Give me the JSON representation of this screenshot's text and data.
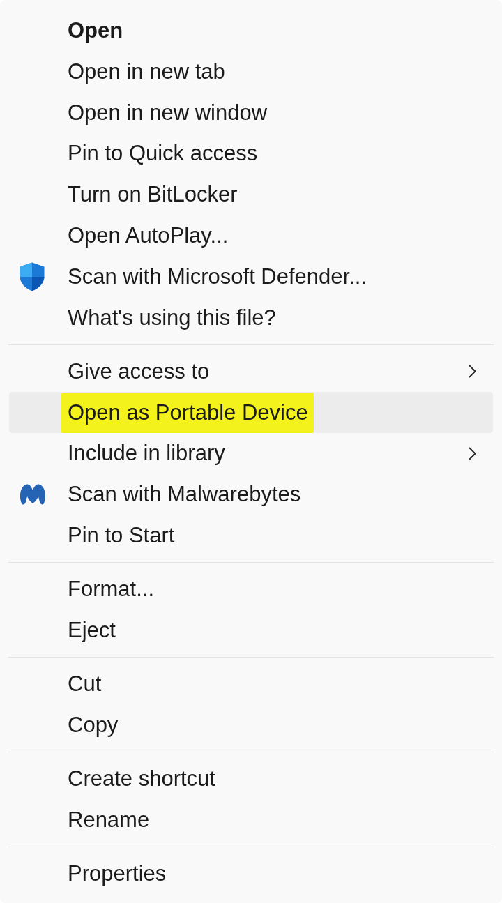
{
  "menu": {
    "groups": [
      {
        "items": [
          {
            "label": "Open",
            "kind": "plain",
            "default": true,
            "submenu": false,
            "selected": false,
            "highlighted": false
          },
          {
            "label": "Open in new tab",
            "kind": "plain",
            "default": false,
            "submenu": false,
            "selected": false,
            "highlighted": false
          },
          {
            "label": "Open in new window",
            "kind": "plain",
            "default": false,
            "submenu": false,
            "selected": false,
            "highlighted": false
          },
          {
            "label": "Pin to Quick access",
            "kind": "plain",
            "default": false,
            "submenu": false,
            "selected": false,
            "highlighted": false
          },
          {
            "label": "Turn on BitLocker",
            "kind": "plain",
            "default": false,
            "submenu": false,
            "selected": false,
            "highlighted": false
          },
          {
            "label": "Open AutoPlay...",
            "kind": "plain",
            "default": false,
            "submenu": false,
            "selected": false,
            "highlighted": false
          },
          {
            "label": "Scan with Microsoft Defender...",
            "kind": "shield",
            "default": false,
            "submenu": false,
            "selected": false,
            "highlighted": false
          },
          {
            "label": "What's using this file?",
            "kind": "plain",
            "default": false,
            "submenu": false,
            "selected": false,
            "highlighted": false
          }
        ]
      },
      {
        "items": [
          {
            "label": "Give access to",
            "kind": "plain",
            "default": false,
            "submenu": true,
            "selected": false,
            "highlighted": false
          },
          {
            "label": "Open as Portable Device",
            "kind": "plain",
            "default": false,
            "submenu": false,
            "selected": true,
            "highlighted": true
          },
          {
            "label": "Include in library",
            "kind": "plain",
            "default": false,
            "submenu": true,
            "selected": false,
            "highlighted": false
          },
          {
            "label": "Scan with Malwarebytes",
            "kind": "emblem",
            "default": false,
            "submenu": false,
            "selected": false,
            "highlighted": false
          },
          {
            "label": "Pin to Start",
            "kind": "plain",
            "default": false,
            "submenu": false,
            "selected": false,
            "highlighted": false
          }
        ]
      },
      {
        "items": [
          {
            "label": "Format...",
            "kind": "plain",
            "default": false,
            "submenu": false,
            "selected": false,
            "highlighted": false
          },
          {
            "label": "Eject",
            "kind": "plain",
            "default": false,
            "submenu": false,
            "selected": false,
            "highlighted": false
          }
        ]
      },
      {
        "items": [
          {
            "label": "Cut",
            "kind": "plain",
            "default": false,
            "submenu": false,
            "selected": false,
            "highlighted": false
          },
          {
            "label": "Copy",
            "kind": "plain",
            "default": false,
            "submenu": false,
            "selected": false,
            "highlighted": false
          }
        ]
      },
      {
        "items": [
          {
            "label": "Create shortcut",
            "kind": "plain",
            "default": false,
            "submenu": false,
            "selected": false,
            "highlighted": false
          },
          {
            "label": "Rename",
            "kind": "plain",
            "default": false,
            "submenu": false,
            "selected": false,
            "highlighted": false
          }
        ]
      },
      {
        "items": [
          {
            "label": "Properties",
            "kind": "plain",
            "default": false,
            "submenu": false,
            "selected": false,
            "highlighted": false
          }
        ]
      }
    ]
  }
}
